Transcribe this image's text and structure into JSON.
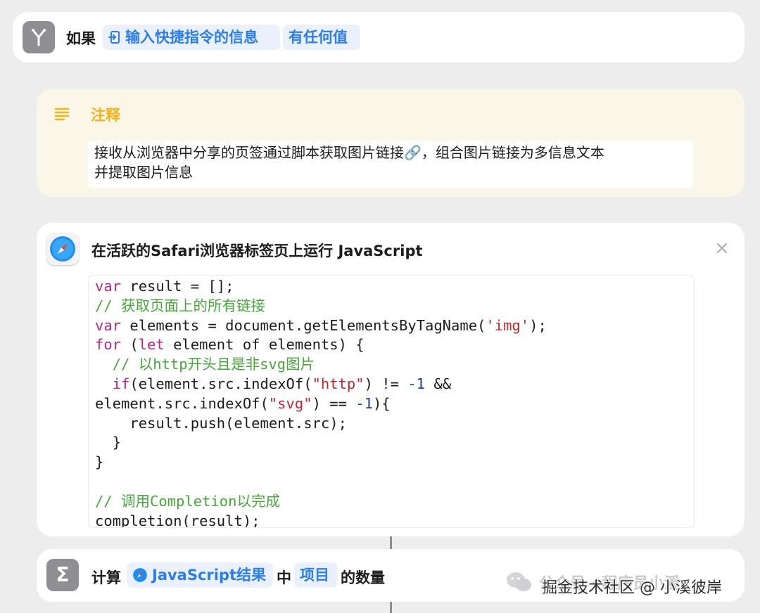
{
  "if_block": {
    "keyword": "如果",
    "input_token": "输入快捷指令的信息",
    "condition_token": "有任何值"
  },
  "comment": {
    "title": "注释",
    "text_line1": "接收从浏览器中分享的页签通过脚本获取图片链接🔗，组合图片链接为多信息文本",
    "text_line2": "并提取图片信息"
  },
  "safari_action": {
    "title": "在活跃的Safari浏览器标签页上运行 JavaScript"
  },
  "calc": {
    "keyword": "计算",
    "js_token": "JavaScript结果",
    "in_word": "中",
    "items_token": "项目",
    "suffix": "的数量"
  },
  "watermark": {
    "line1": "公众号 · 程序员小溪",
    "line2": "掘金技术社区 @ 小溪彼岸"
  },
  "colors": {
    "accent": "#2a7df2",
    "comment_title": "#f5b31b",
    "keyword": "#b5258f",
    "comment_code": "#45a93a",
    "string": "#c0282e",
    "number": "#1d3ea8"
  }
}
